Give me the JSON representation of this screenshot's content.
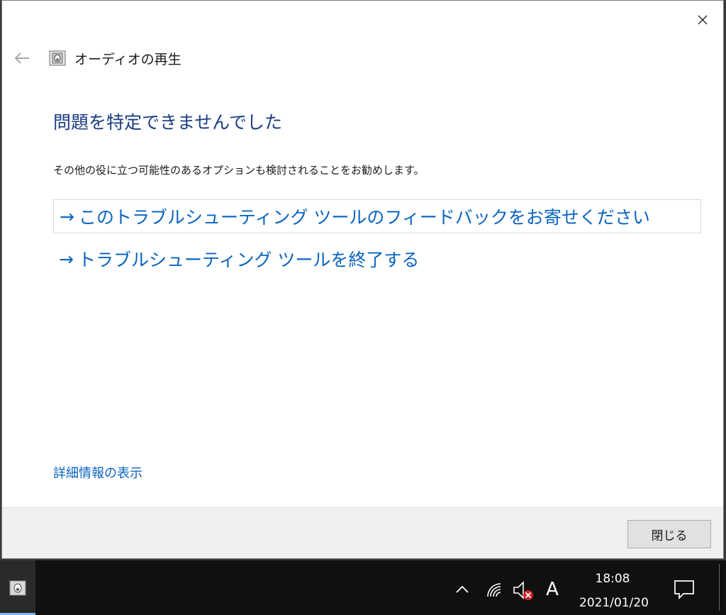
{
  "window": {
    "header_title": "オーディオの再生",
    "heading": "問題を特定できませんでした",
    "description": "その他の役に立つ可能性のあるオプションも検討されることをお勧めします。",
    "links": [
      {
        "arrow": "→",
        "label": "このトラブルシューティング ツールのフィードバックをお寄せください"
      },
      {
        "arrow": "→",
        "label": "トラブルシューティング ツールを終了する"
      }
    ],
    "details_link": "詳細情報の表示",
    "close_button": "閉じる"
  },
  "taskbar": {
    "ime_indicator": "A",
    "clock_time": "18:08",
    "clock_date": "2021/01/20"
  },
  "colors": {
    "heading": "#1b3d82",
    "link": "#0a64c0",
    "taskbar": "#101010"
  },
  "icons": [
    "close-icon",
    "back-arrow-icon",
    "troubleshooter-icon",
    "chevron-up-icon",
    "wifi-icon",
    "speaker-muted-icon",
    "notification-icon"
  ]
}
